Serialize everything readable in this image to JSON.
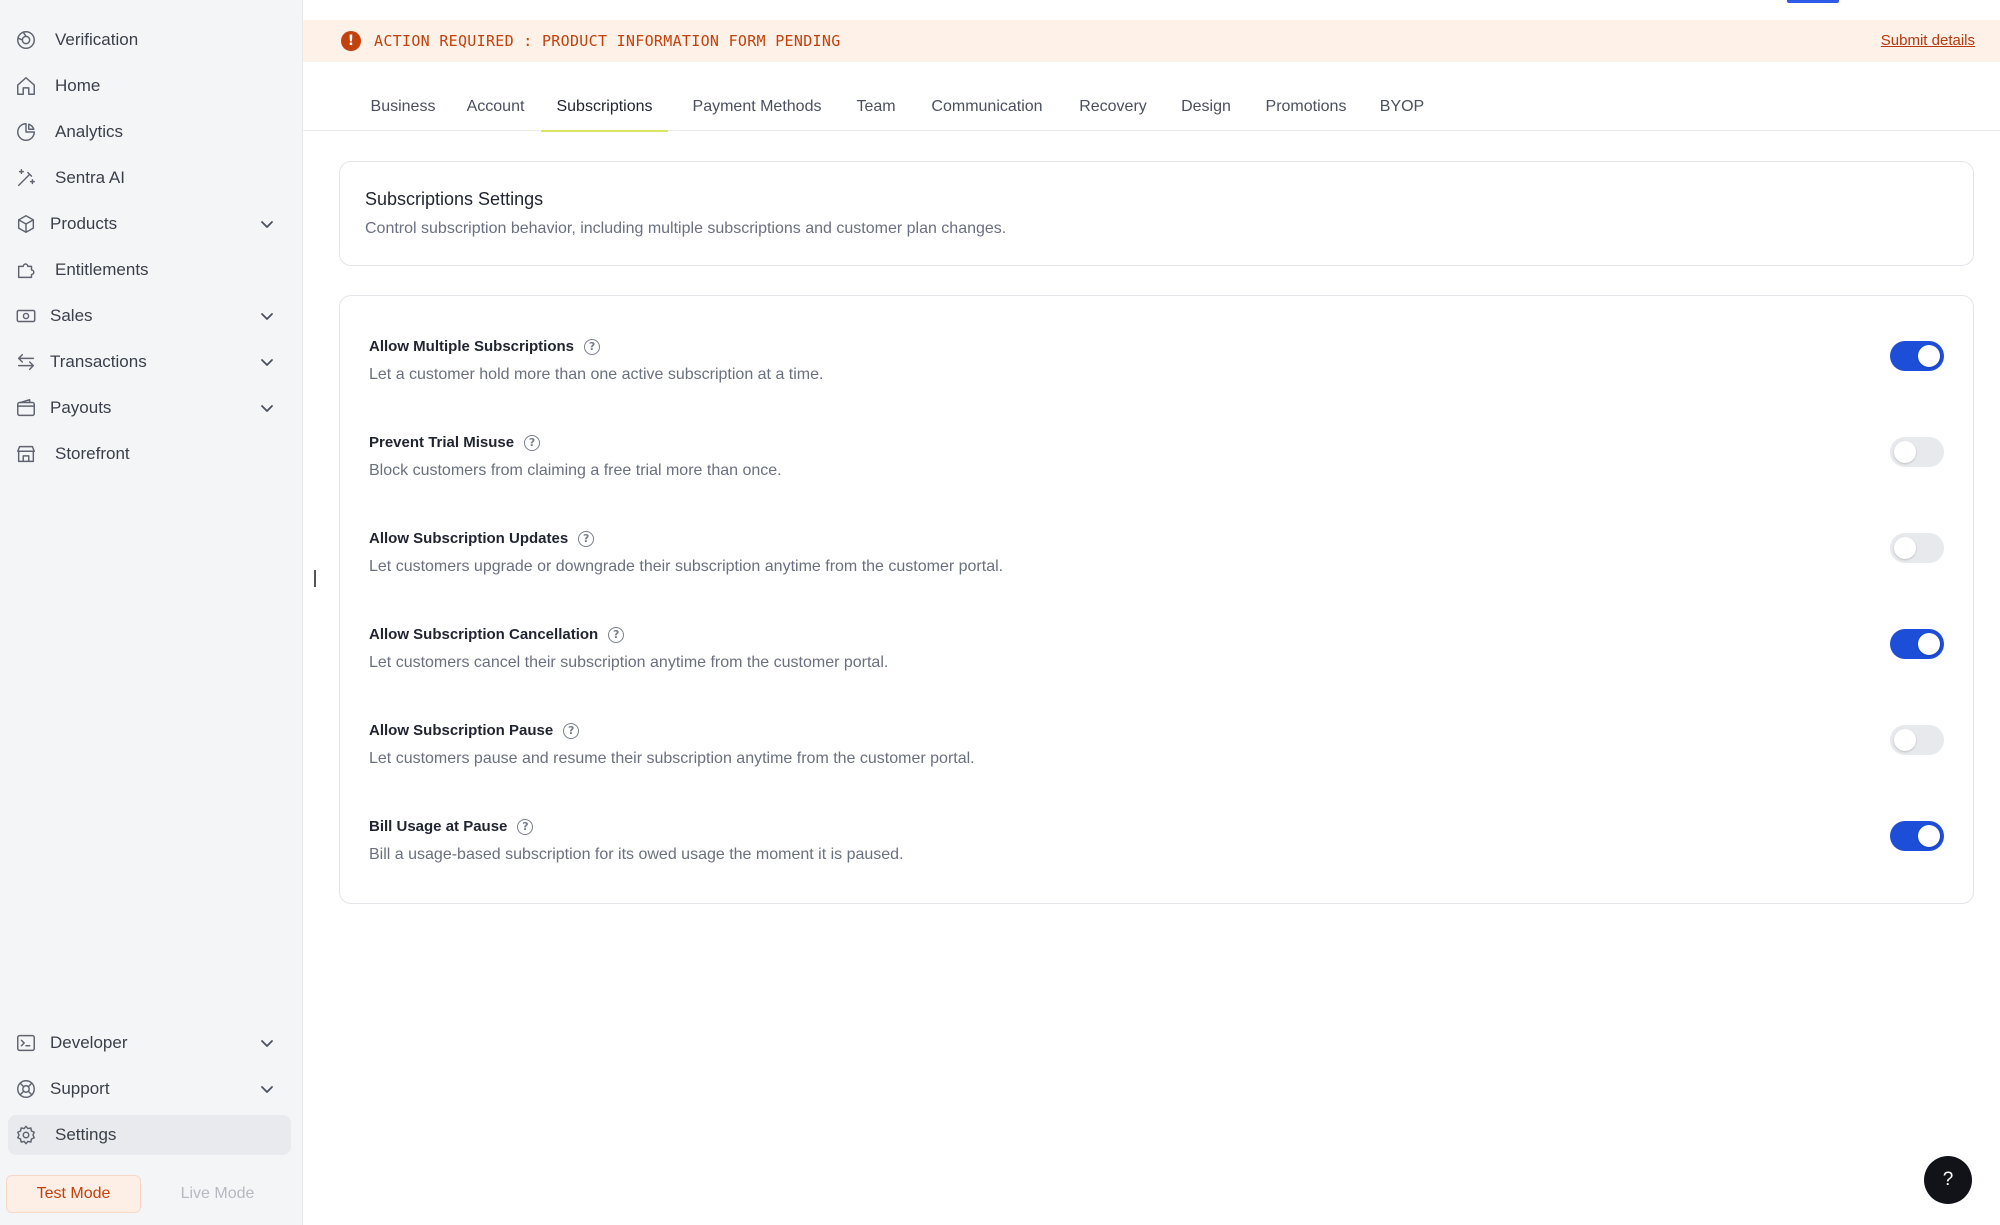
{
  "sidebar": {
    "items": [
      {
        "label": "Verification",
        "icon": "verification-icon"
      },
      {
        "label": "Home",
        "icon": "home-icon"
      },
      {
        "label": "Analytics",
        "icon": "analytics-icon"
      },
      {
        "label": "Sentra AI",
        "icon": "magic-wand-icon"
      },
      {
        "label": "Products",
        "icon": "box-icon",
        "expandable": true
      },
      {
        "label": "Entitlements",
        "icon": "puzzle-icon"
      },
      {
        "label": "Sales",
        "icon": "banknote-icon",
        "expandable": true
      },
      {
        "label": "Transactions",
        "icon": "arrows-exchange-icon",
        "expandable": true
      },
      {
        "label": "Payouts",
        "icon": "wallet-icon",
        "expandable": true
      },
      {
        "label": "Storefront",
        "icon": "store-icon"
      }
    ],
    "bottom_items": [
      {
        "label": "Developer",
        "icon": "terminal-icon",
        "expandable": true
      },
      {
        "label": "Support",
        "icon": "lifebuoy-icon",
        "expandable": true
      },
      {
        "label": "Settings",
        "icon": "gear-icon",
        "active": true
      }
    ],
    "mode": {
      "test_label": "Test Mode",
      "live_label": "Live Mode",
      "selected": "Test Mode"
    }
  },
  "banner": {
    "icon": "alert-icon",
    "message": "ACTION REQUIRED : PRODUCT INFORMATION FORM PENDING",
    "link": "Submit details",
    "color": "#c2410c"
  },
  "tabs": [
    {
      "label": "Business"
    },
    {
      "label": "Account"
    },
    {
      "label": "Subscriptions",
      "active": true
    },
    {
      "label": "Payment Methods"
    },
    {
      "label": "Team"
    },
    {
      "label": "Communication"
    },
    {
      "label": "Recovery"
    },
    {
      "label": "Design"
    },
    {
      "label": "Promotions"
    },
    {
      "label": "BYOP"
    }
  ],
  "header_card": {
    "title": "Subscriptions Settings",
    "subtitle": "Control subscription behavior, including multiple subscriptions and customer plan changes."
  },
  "settings": [
    {
      "label": "Allow Multiple Subscriptions",
      "description": "Let a customer hold more than one active subscription at a time.",
      "enabled": true
    },
    {
      "label": "Prevent Trial Misuse",
      "description": "Block customers from claiming a free trial more than once.",
      "enabled": false
    },
    {
      "label": "Allow Subscription Updates",
      "description": "Let customers upgrade or downgrade their subscription anytime from the customer portal.",
      "enabled": false
    },
    {
      "label": "Allow Subscription Cancellation",
      "description": "Let customers cancel their subscription anytime from the customer portal.",
      "enabled": true
    },
    {
      "label": "Allow Subscription Pause",
      "description": "Let customers pause and resume their subscription anytime from the customer portal.",
      "enabled": false
    },
    {
      "label": "Bill Usage at Pause",
      "description": "Bill a usage-based subscription for its owed usage the moment it is paused.",
      "enabled": true
    }
  ],
  "help_fab": {
    "label": "?"
  },
  "colors": {
    "accent": "#1d4ed8",
    "tab_underline": "#d8e36a",
    "banner_bg": "#fdf1e8"
  }
}
